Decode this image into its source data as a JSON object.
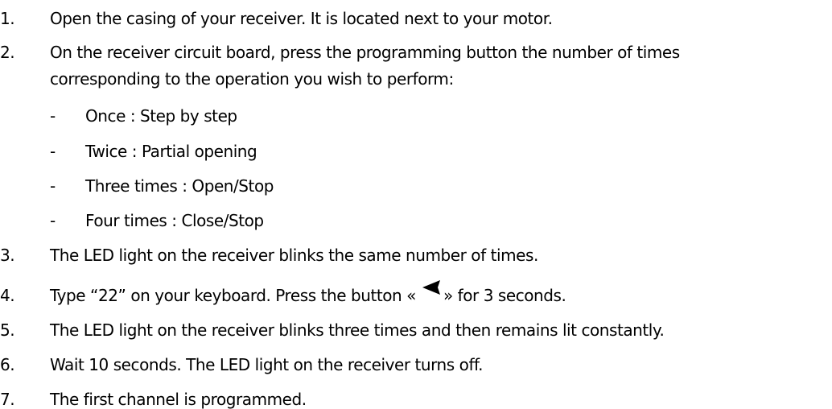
{
  "steps": [
    {
      "num": "1.",
      "text": "Open the casing of your receiver. It is located next to your motor."
    },
    {
      "num": "2.",
      "text": "On the receiver circuit board, press the programming button the number of times",
      "text2": "corresponding to the operation you wish to perform:"
    },
    {
      "num": "3.",
      "text": "The LED light on the receiver blinks the same number of times."
    },
    {
      "num": "4.",
      "text_before": "Type “22” on your keyboard. Press the button «",
      "text_after": "» for 3 seconds.",
      "icon": "back-arrow-icon"
    },
    {
      "num": "5.",
      "text": "The LED light on the receiver blinks three times and then remains lit constantly."
    },
    {
      "num": "6.",
      "text": "Wait 10 seconds. The LED light on the receiver turns off."
    },
    {
      "num": "7.",
      "text": "The first channel is programmed."
    }
  ],
  "suboptions": [
    {
      "dash": "-",
      "text": "Once : Step by step"
    },
    {
      "dash": "-",
      "text": "Twice : Partial opening"
    },
    {
      "dash": "-",
      "text": "Three times : Open/Stop"
    },
    {
      "dash": "-",
      "text": "Four times : Close/Stop"
    }
  ]
}
